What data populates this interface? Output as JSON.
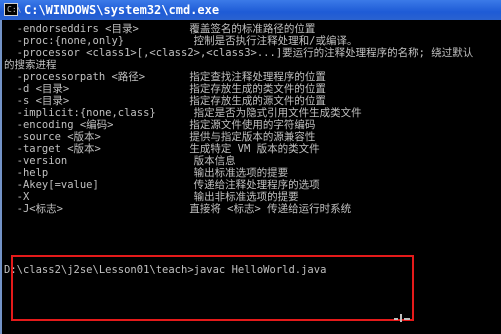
{
  "window": {
    "title": "C:\\WINDOWS\\system32\\cmd.exe",
    "icon": "console-icon"
  },
  "console": {
    "lines": [
      "  -endorseddirs <目录>        覆盖签名的标准路径的位置",
      "  -proc:{none,only}           控制是否执行注释处理和/或编译。",
      "  -processor <class1>[,<class2>,<class3>...]要运行的注释处理程序的名称; 绕过默认",
      "的搜索进程",
      "  -processorpath <路径>       指定查找注释处理程序的位置",
      "  -d <目录>                   指定存放生成的类文件的位置",
      "  -s <目录>                   指定存放生成的源文件的位置",
      "  -implicit:{none,class}      指定是否为隐式引用文件生成类文件",
      "  -encoding <编码>            指定源文件使用的字符编码",
      "  -source <版本>              提供与指定版本的源兼容性",
      "  -target <版本>              生成特定 VM 版本的类文件",
      "  -version                    版本信息",
      "  -help                       输出标准选项的提要",
      "  -Akey[=value]               传递给注释处理程序的选项",
      "  -X                          输出非标准选项的提要",
      "  -J<标志>                    直接将 <标志> 传递给运行时系统"
    ],
    "prompt_line": "D:\\class2\\j2se\\Lesson01\\teach>javac HelloWorld.java"
  }
}
